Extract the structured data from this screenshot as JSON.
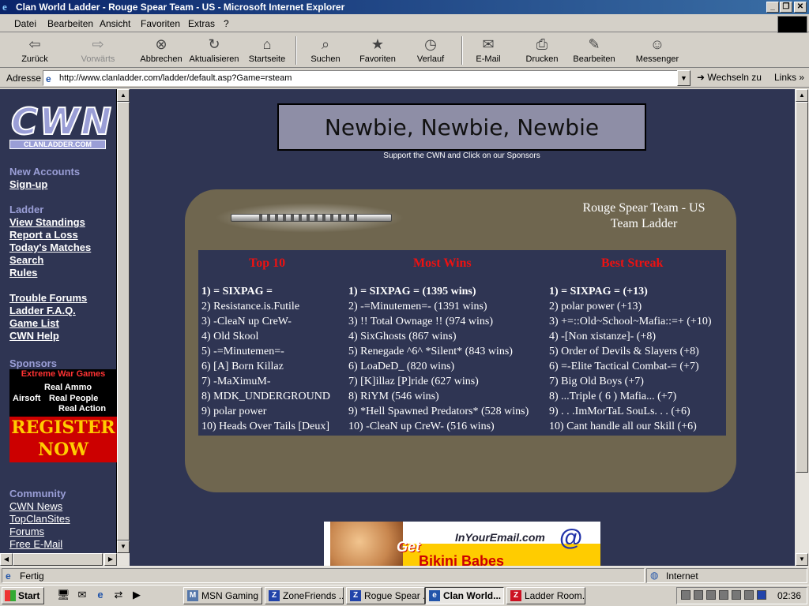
{
  "window": {
    "title": "Clan World Ladder - Rouge Spear Team - US - Microsoft Internet Explorer"
  },
  "menu": [
    "Datei",
    "Bearbeiten",
    "Ansicht",
    "Favoriten",
    "Extras",
    "?"
  ],
  "toolbar": [
    {
      "label": "Zurück",
      "icon": "back-arrow-icon"
    },
    {
      "label": "Vorwärts",
      "icon": "forward-arrow-icon"
    },
    {
      "label": "Abbrechen",
      "icon": "stop-icon"
    },
    {
      "label": "Aktualisieren",
      "icon": "refresh-icon"
    },
    {
      "label": "Startseite",
      "icon": "home-icon"
    },
    {
      "label": "Suchen",
      "icon": "search-icon"
    },
    {
      "label": "Favoriten",
      "icon": "favorites-icon"
    },
    {
      "label": "Verlauf",
      "icon": "history-icon"
    },
    {
      "label": "E-Mail",
      "icon": "mail-icon"
    },
    {
      "label": "Drucken",
      "icon": "print-icon"
    },
    {
      "label": "Bearbeiten",
      "icon": "edit-icon"
    },
    {
      "label": "Messenger",
      "icon": "messenger-icon"
    }
  ],
  "address": {
    "label": "Adresse",
    "url": "http://www.clanladder.com/ladder/default.asp?Game=rsteam",
    "go": "Wechseln zu",
    "links": "Links"
  },
  "nav": {
    "logo": "CWN",
    "logo_sub": "CLANLADDER.COM",
    "new_accounts_heading": "New Accounts",
    "signup": "Sign-up",
    "ladder_heading": "Ladder",
    "view_standings": "View Standings",
    "report_loss": "Report a Loss",
    "todays_matches": "Today's Matches",
    "search": "Search",
    "rules": "Rules",
    "trouble_forums": "Trouble Forums",
    "faq": "Ladder F.A.Q.",
    "game_list": "Game List",
    "help": "CWN Help",
    "sponsors_heading": "Sponsors",
    "community_heading": "Community",
    "cwn_news": "CWN News",
    "topclansites": "TopClanSites",
    "forums": "Forums",
    "free_email": "Free E-Mail"
  },
  "sponsor_ad": {
    "line1": "Extreme War Games",
    "line2": "Real Ammo",
    "line3": "Airsoft",
    "line4": "Real People",
    "line5": "Real Action",
    "register": "REGISTER NOW"
  },
  "banner": {
    "text": "Newbie, Newbie, Newbie",
    "support": "Support the CWN and Click on our Sponsors"
  },
  "ladder": {
    "title_line1": "Rouge Spear Team - US",
    "title_line2": "Team Ladder",
    "columns": [
      "Top 10",
      "Most Wins",
      "Best Streak"
    ],
    "top10": [
      "1) = SIXPAG =",
      "2) Resistance.is.Futile",
      "3) -CleaN up CreW-",
      "4) Old Skool",
      "5) -=Minutemen=-",
      "6) [A] Born Killaz",
      "7) -MaXimuM-",
      "8) MDK_UNDERGROUND",
      "9) polar power",
      "10) Heads Over Tails [Deux]"
    ],
    "most_wins": [
      "1) = SIXPAG = (1395 wins)",
      "2) -=Minutemen=- (1391 wins)",
      "3) !! Total Ownage !! (974 wins)",
      "4) SixGhosts (867 wins)",
      "5) Renegade ^6^ *Silent* (843 wins)",
      "6) LoaDeD_ (820 wins)",
      "7) [K]illaz [P]ride (627 wins)",
      "8) RiYM (546 wins)",
      "9) *Hell Spawned Predators* (528 wins)",
      "10) -CleaN up CreW- (516 wins)"
    ],
    "best_streak": [
      "1) = SIXPAG = (+13)",
      "2) polar power (+13)",
      "3) +=::Old~School~Mafia::=+ (+10)",
      "4) -[Non xistanze]- (+8)",
      "5) Order of Devils & Slayers (+8)",
      "6) =-Elite Tactical Combat-= (+7)",
      "7) Big Old Boys (+7)",
      "8) ...Triple ( 6 ) Mafia... (+7)",
      "9) . . .ImMorTaL SouLs. . . (+6)",
      "10) Cant handle all our Skill (+6)"
    ]
  },
  "bottom_ad": {
    "brand": "InYourEmail.com",
    "get": "Get",
    "text": "Bikini Babes"
  },
  "status": {
    "text": "Fertig",
    "zone": "Internet"
  },
  "taskbar": {
    "start": "Start",
    "tasks": [
      "MSN Gaming ...",
      "ZoneFriends ...",
      "Rogue Spear ...",
      "Clan World...",
      "Ladder Room..."
    ],
    "clock": "02:36"
  }
}
